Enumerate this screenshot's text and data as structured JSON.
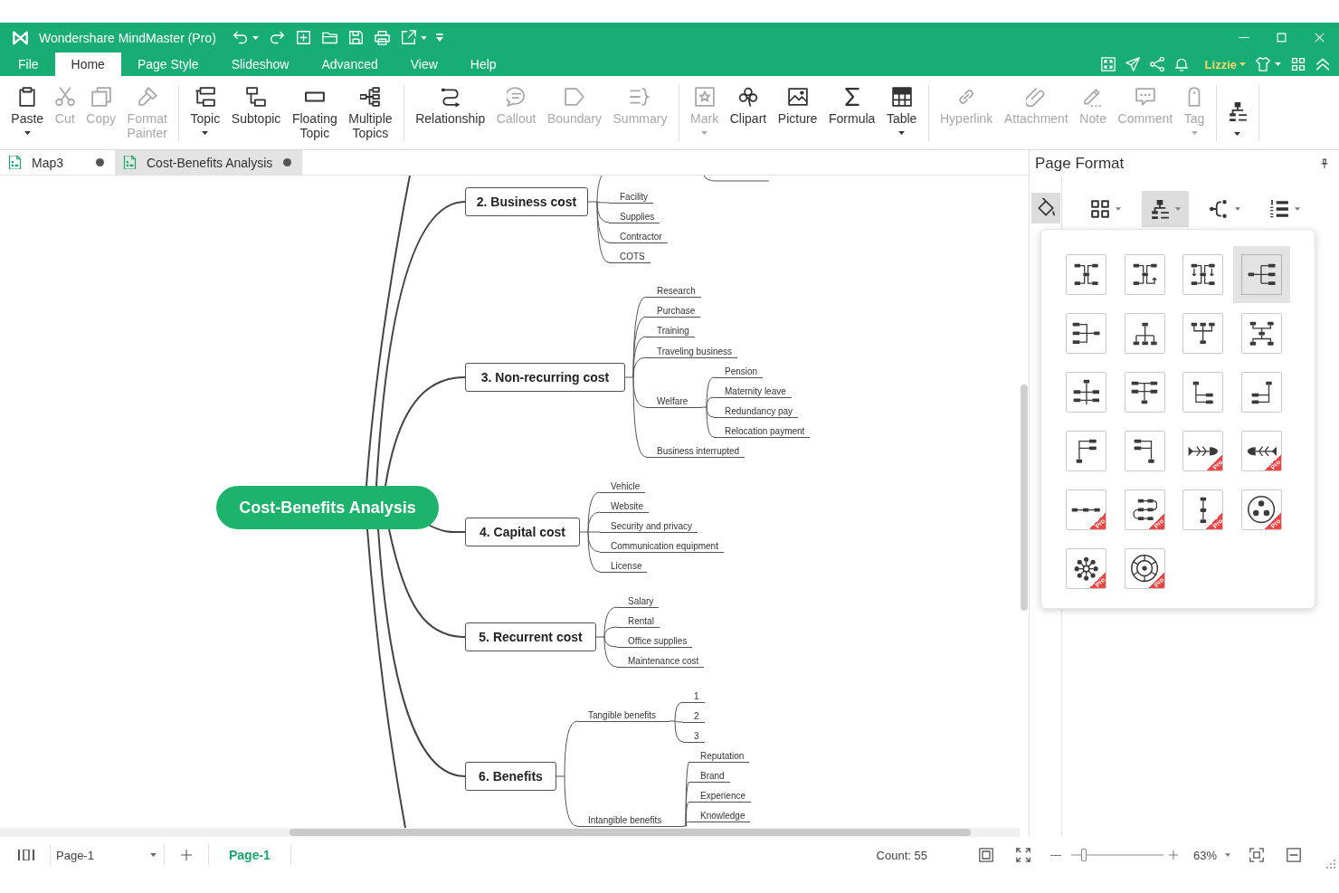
{
  "window": {
    "title": "Wondershare MindMaster (Pro)"
  },
  "menu_tabs": [
    {
      "label": "File",
      "selected": false
    },
    {
      "label": "Home",
      "selected": true
    },
    {
      "label": "Page Style",
      "selected": false
    },
    {
      "label": "Slideshow",
      "selected": false
    },
    {
      "label": "Advanced",
      "selected": false
    },
    {
      "label": "View",
      "selected": false
    },
    {
      "label": "Help",
      "selected": false
    }
  ],
  "account": {
    "user": "Lizzie"
  },
  "ribbon": [
    {
      "buttons": [
        {
          "label": "Paste",
          "disabled": false,
          "dropdown": true
        },
        {
          "label": "Cut",
          "disabled": true,
          "dropdown": false
        },
        {
          "label": "Copy",
          "disabled": true,
          "dropdown": false
        },
        {
          "label": "Format Painter",
          "disabled": true,
          "dropdown": false
        }
      ]
    },
    {
      "buttons": [
        {
          "label": "Topic",
          "disabled": false,
          "dropdown": true
        },
        {
          "label": "Subtopic",
          "disabled": false,
          "dropdown": false
        },
        {
          "label": "Floating Topic",
          "disabled": false,
          "dropdown": false
        },
        {
          "label": "Multiple Topics",
          "disabled": false,
          "dropdown": false
        }
      ]
    },
    {
      "buttons": [
        {
          "label": "Relationship",
          "disabled": false,
          "dropdown": false
        },
        {
          "label": "Callout",
          "disabled": true,
          "dropdown": false
        },
        {
          "label": "Boundary",
          "disabled": true,
          "dropdown": false
        },
        {
          "label": "Summary",
          "disabled": true,
          "dropdown": false
        }
      ]
    },
    {
      "buttons": [
        {
          "label": "Mark",
          "disabled": true,
          "dropdown": true
        },
        {
          "label": "Clipart",
          "disabled": false,
          "dropdown": false
        },
        {
          "label": "Picture",
          "disabled": false,
          "dropdown": false
        },
        {
          "label": "Formula",
          "disabled": false,
          "dropdown": false
        },
        {
          "label": "Table",
          "disabled": false,
          "dropdown": true
        }
      ]
    },
    {
      "buttons": [
        {
          "label": "Hyperlink",
          "disabled": true,
          "dropdown": false
        },
        {
          "label": "Attachment",
          "disabled": true,
          "dropdown": false
        },
        {
          "label": "Note",
          "disabled": true,
          "dropdown": false
        },
        {
          "label": "Comment",
          "disabled": true,
          "dropdown": false
        },
        {
          "label": "Tag",
          "disabled": true,
          "dropdown": true
        }
      ]
    },
    {
      "buttons": [
        {
          "disabled": false,
          "dropdown": true
        }
      ]
    }
  ],
  "documents": [
    {
      "name": "Map3",
      "selected": false,
      "modified": true
    },
    {
      "name": "Cost-Benefits Analysis",
      "selected": true,
      "modified": true
    }
  ],
  "mind_map": {
    "central": "Cost-Benefits Analysis",
    "topics": [
      {
        "label": "2. Business cost",
        "children": [
          {
            "label": "Facility"
          },
          {
            "label": "Supplies"
          },
          {
            "label": "Contractor"
          },
          {
            "label": "COTS"
          }
        ]
      },
      {
        "label": "3. Non-recurring cost",
        "children": [
          {
            "label": "Research"
          },
          {
            "label": "Purchase"
          },
          {
            "label": "Training"
          },
          {
            "label": "Traveling business"
          },
          {
            "label": "Welfare",
            "children": [
              {
                "label": "Pension"
              },
              {
                "label": "Maternity leave"
              },
              {
                "label": "Redundancy pay"
              },
              {
                "label": "Relocation payment"
              }
            ]
          },
          {
            "label": "Business interrupted"
          }
        ]
      },
      {
        "label": "4. Capital cost",
        "children": [
          {
            "label": "Vehicle"
          },
          {
            "label": "Website"
          },
          {
            "label": "Security and privacy"
          },
          {
            "label": "Communication equipment"
          },
          {
            "label": "License"
          }
        ]
      },
      {
        "label": "5. Recurrent cost",
        "children": [
          {
            "label": "Salary"
          },
          {
            "label": "Rental"
          },
          {
            "label": "Office supplies"
          },
          {
            "label": "Maintenance cost"
          }
        ]
      },
      {
        "label": "6. Benefits",
        "children": [
          {
            "label": "Tangible benefits",
            "children": [
              {
                "label": "1"
              },
              {
                "label": "2"
              },
              {
                "label": "3"
              }
            ]
          },
          {
            "label": "Intangible benefits",
            "children": [
              {
                "label": "Reputation"
              },
              {
                "label": "Brand"
              },
              {
                "label": "Experience"
              },
              {
                "label": "Knowledge"
              }
            ]
          }
        ]
      }
    ]
  },
  "format_panel": {
    "title": "Page Format",
    "side_tabs": [
      {
        "selected": true
      }
    ],
    "tools": [
      {
        "selected": false,
        "dropdown": true
      },
      {
        "selected": true,
        "dropdown": true
      },
      {
        "selected": false,
        "dropdown": true
      },
      {
        "selected": false,
        "dropdown": true
      }
    ],
    "layouts": [
      {
        "kind": "mindmap",
        "selected": false
      },
      {
        "kind": "clockwise",
        "selected": false
      },
      {
        "kind": "inward",
        "selected": false
      },
      {
        "kind": "rightmap",
        "selected": true
      },
      {
        "kind": "leftmap",
        "selected": false
      },
      {
        "kind": "orgdown",
        "selected": false
      },
      {
        "kind": "orgup",
        "selected": false
      },
      {
        "kind": "orgboth",
        "selected": false
      },
      {
        "kind": "treeboth",
        "selected": false
      },
      {
        "kind": "orgcenter",
        "selected": false
      },
      {
        "kind": "treeright",
        "selected": false
      },
      {
        "kind": "treeleft",
        "selected": false
      },
      {
        "kind": "treeupright",
        "selected": false
      },
      {
        "kind": "treeupleft",
        "selected": false
      },
      {
        "kind": "fishright",
        "selected": false,
        "badge": "Pro"
      },
      {
        "kind": "fishleft",
        "selected": false,
        "badge": "Pro"
      },
      {
        "kind": "timeline",
        "selected": false,
        "badge": "Pro"
      },
      {
        "kind": "winding",
        "selected": false,
        "badge": "Pro"
      },
      {
        "kind": "vertical",
        "selected": false,
        "badge": "Pro"
      },
      {
        "kind": "circle",
        "selected": false,
        "badge": "Pro"
      },
      {
        "kind": "bubble",
        "selected": false,
        "badge": "Pro"
      },
      {
        "kind": "sector",
        "selected": false,
        "badge": "Pro"
      }
    ]
  },
  "status_bar": {
    "page_select": "Page-1",
    "pages": [
      {
        "label": "Page-1",
        "selected": true
      }
    ],
    "count": "Count: 55",
    "zoom": {
      "level": 0.14,
      "reading": "63%"
    }
  }
}
